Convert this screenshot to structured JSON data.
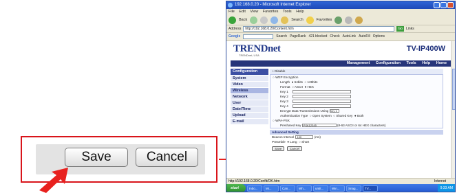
{
  "callout": {
    "save_label": "Save",
    "cancel_label": "Cancel"
  },
  "browser": {
    "title": "192.168.0.20 - Microsoft Internet Explorer",
    "menu": [
      "File",
      "Edit",
      "View",
      "Favorites",
      "Tools",
      "Help"
    ],
    "toolbar": {
      "back": "Back",
      "search": "Search",
      "favorites": "Favorites"
    },
    "address_label": "Address",
    "address": "http://192.168.0.20/Content.htm",
    "go_label": "Go",
    "links_label": "Links",
    "google": {
      "logo": "Google",
      "search": "Search",
      "pagerank": "PageRank",
      "blocked": "421 blocked",
      "check": "Check",
      "autolink": "AutoLink",
      "autofill": "AutoFill",
      "options": "Options"
    },
    "status_left": "http://192.168.0.20/Confit/OK.htm",
    "status_zone": "Internet",
    "taskbar": {
      "start": "start",
      "tasks": [
        "Inbo...",
        "Mi...",
        "Can...",
        "Wh...",
        "untit...",
        "Win...",
        "Snag...",
        "TV..."
      ],
      "clock": "9:33 AM"
    }
  },
  "page": {
    "logo": "TRENDnet",
    "logo_sub": "TRENDnet, USA",
    "model": "TV-IP400W",
    "nav": [
      "Management",
      "Configuration",
      "Tools",
      "Help",
      "Home"
    ],
    "sidebar_head": "Configuration",
    "sidebar": [
      "System",
      "Video",
      "Wireless",
      "Network",
      "User",
      "Date/Time",
      "Upload",
      "E-mail"
    ],
    "sidebar_active": "Wireless",
    "disable": "Disable",
    "wep": "WEP Encryption",
    "length_label": "Length",
    "length_opts": [
      "64bits",
      "128bits"
    ],
    "format_label": "Format",
    "format_opts": [
      "ASCII",
      "HEX"
    ],
    "keys": [
      "Key 1",
      "Key 2",
      "Key 3",
      "Key 4"
    ],
    "encrypt_label": "Encrypt Data Transmissions Using",
    "encrypt_value": "Key 1",
    "auth_label": "Authentication Type",
    "auth_opts": [
      "Open System",
      "Shared Key",
      "Both"
    ],
    "wpa": "WPA-PSK",
    "psk_label": "Preshared Key",
    "psk_value": "PSK12345",
    "psk_hint": "(8-63 ASCII or 64 HEX characters)",
    "advanced": "Advanced Setting",
    "beacon_label": "Beacon Interval",
    "beacon_value": "100",
    "beacon_unit": "(ms)",
    "preamble_label": "Preamble",
    "preamble_opts": [
      "Long",
      "Short"
    ],
    "save": "Save",
    "cancel": "Cancel"
  },
  "colors": {
    "callout_border": "#d9141a",
    "arrow": "#e8211e",
    "nav_bar": "#27357a"
  }
}
